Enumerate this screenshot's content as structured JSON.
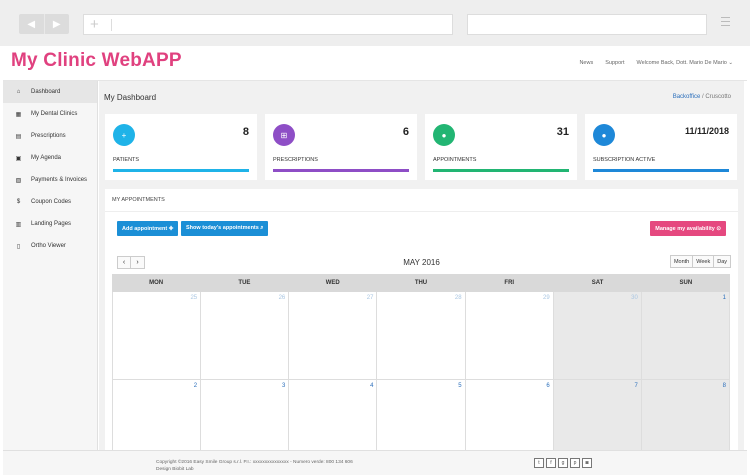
{
  "app": {
    "title": "My Clinic WebAPP"
  },
  "header": {
    "nav": [
      "News",
      "Support",
      "Welcome Back, Dott. Mario De Mario"
    ]
  },
  "sidebar": {
    "items": [
      {
        "label": "Dashboard",
        "icon": "home-icon",
        "glyph": "⌂"
      },
      {
        "label": "My Dental Clinics",
        "icon": "building-icon",
        "glyph": "▦"
      },
      {
        "label": "Prescriptions",
        "icon": "document-icon",
        "glyph": "▤"
      },
      {
        "label": "My Agenda",
        "icon": "calendar-icon",
        "glyph": "▣"
      },
      {
        "label": "Payments & Invoices",
        "icon": "invoice-icon",
        "glyph": "▧"
      },
      {
        "label": "Coupon Codes",
        "icon": "dollar-icon",
        "glyph": "$"
      },
      {
        "label": "Landing Pages",
        "icon": "page-icon",
        "glyph": "▥"
      },
      {
        "label": "Ortho Viewer",
        "icon": "mobile-icon",
        "glyph": "▯"
      }
    ]
  },
  "page": {
    "title": "My Dashboard",
    "breadcrumb": [
      "Backoffice",
      "/",
      "Cruscotto"
    ]
  },
  "cards": [
    {
      "label": "PATIENTS",
      "value": "8",
      "color": "#1fb3e8",
      "icon": "patient-add-icon",
      "glyph": "+"
    },
    {
      "label": "PRESCRIPTIONS",
      "value": "6",
      "color": "#8e4ec6",
      "icon": "cart-icon",
      "glyph": "⊞"
    },
    {
      "label": "APPOINTMENTS",
      "value": "31",
      "color": "#22b573",
      "icon": "users-icon",
      "glyph": "●"
    },
    {
      "label": "SUBSCRIPTION ACTIVE",
      "value": "11/11/2018",
      "color": "#1e88d8",
      "icon": "group-icon",
      "glyph": "●"
    }
  ],
  "appointments": {
    "title": "MY APPOINTMENTS",
    "add_label": "Add appointment ✚",
    "today_label": "Show today's appointments ⌕",
    "manage_label": "Manage my availability ⊙"
  },
  "calendar": {
    "title": "MAY 2016",
    "prev": "‹",
    "next": "›",
    "views": [
      "Month",
      "Week",
      "Day"
    ],
    "days": [
      "MON",
      "TUE",
      "WED",
      "THU",
      "FRI",
      "SAT",
      "SUN"
    ],
    "weeks": [
      [
        {
          "d": "25",
          "other": true
        },
        {
          "d": "26",
          "other": true
        },
        {
          "d": "27",
          "other": true
        },
        {
          "d": "28",
          "other": true
        },
        {
          "d": "29",
          "other": true
        },
        {
          "d": "30",
          "other": true
        },
        {
          "d": "1",
          "other": false
        }
      ],
      [
        {
          "d": "2",
          "other": false
        },
        {
          "d": "3",
          "other": false
        },
        {
          "d": "4",
          "other": false
        },
        {
          "d": "5",
          "other": false
        },
        {
          "d": "6",
          "other": false
        },
        {
          "d": "7",
          "other": false
        },
        {
          "d": "8",
          "other": false
        }
      ]
    ]
  },
  "footer": {
    "copyright": "Copyright ©2016 Easy Smile Group s.r.l. P.I.: xxxxxxxxxxxxxxx - Numero verde: 800 134 606",
    "design": "Design Biobit Lab",
    "social": [
      {
        "name": "twitter-icon",
        "glyph": "t"
      },
      {
        "name": "facebook-icon",
        "glyph": "f"
      },
      {
        "name": "google-plus-icon",
        "glyph": "g"
      },
      {
        "name": "pinterest-icon",
        "glyph": "p"
      },
      {
        "name": "instagram-icon",
        "glyph": "◙"
      }
    ]
  }
}
